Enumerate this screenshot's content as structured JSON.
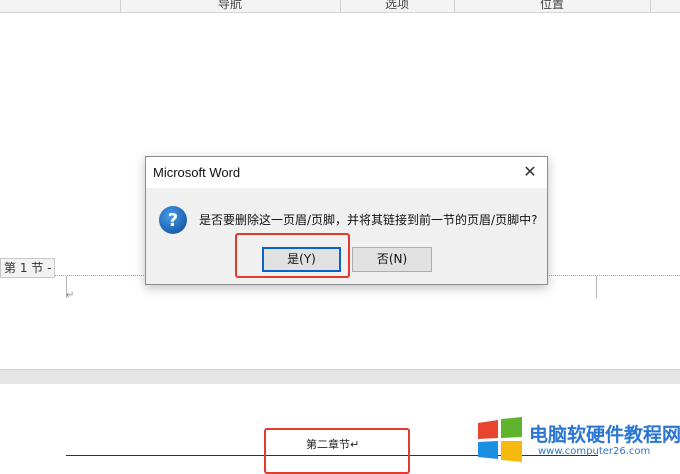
{
  "ribbon": {
    "groups": [
      "导航",
      "选项",
      "位置"
    ]
  },
  "document": {
    "section_tag": "第 1 节 -",
    "paragraph_mark": "↵",
    "chapter_title": "第二章节↵"
  },
  "dialog": {
    "title": "Microsoft Word",
    "close_label": "✕",
    "message": "是否要删除这一页眉/页脚，并将其链接到前一节的页眉/页脚中?",
    "yes_label": "是(Y)",
    "no_label": "否(N)"
  },
  "watermark": {
    "title": "电脑软硬件教程网",
    "url": "www.computer26.com"
  },
  "colors": {
    "highlight": "#e23b2e",
    "accent_blue": "#0a64c8",
    "question_icon": "#1f6fc5",
    "watermark": "#2a76d2"
  }
}
